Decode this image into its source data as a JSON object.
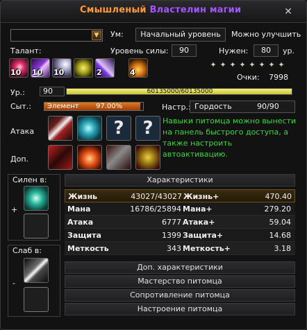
{
  "window": {
    "title_part1": "Смышленый",
    "title_part2": "Властелин магии"
  },
  "mind": {
    "label": "Ум:",
    "value": "Начальный уровень",
    "improve": "Можно улучшить"
  },
  "talent": {
    "label": "Талант:"
  },
  "talents": [
    {
      "level": "10",
      "icon": "pink-burst-icon"
    },
    {
      "level": "10",
      "icon": "purple-beam-icon"
    },
    {
      "level": "10",
      "icon": "white-rays-icon"
    },
    {
      "level": "",
      "icon": "yellow-orb-icon"
    },
    {
      "level": "2",
      "icon": "violet-slash-icon"
    },
    {
      "level": "4",
      "icon": "orange-spiral-icon"
    }
  ],
  "power": {
    "label": "Уровень силы:",
    "value": "90"
  },
  "needed": {
    "label": "Нужен:",
    "value": "80",
    "unit": "ур."
  },
  "points": {
    "label": "Очки:",
    "value": "7998",
    "stars_filled": 8,
    "stars_total": 8
  },
  "level": {
    "label": "Ур.:",
    "value": "90",
    "xp_text": "60135000/60135000",
    "xp_fraction": 1.0
  },
  "satiety": {
    "label": "Сыт.:",
    "element_label": "Элемент",
    "value_text": "97.00%",
    "fraction": 0.97
  },
  "mood": {
    "label": "Настр.:",
    "value": "Гордость",
    "count": "90/90"
  },
  "attack": {
    "label": "Атака"
  },
  "extra": {
    "label": "Доп."
  },
  "info_text": "Навыки питомца можно вынести на панель быстрого доступа, а также настроить автоактивацию.",
  "strong": {
    "label": "Силен в:",
    "sign": "+"
  },
  "weak": {
    "label": "Слаб в:",
    "sign": "-"
  },
  "characteristics": {
    "header": "Характеристики",
    "rows": [
      {
        "k1": "Жизнь",
        "v1": "43027/43027",
        "k2": "Жизнь+",
        "v2": "470.40"
      },
      {
        "k1": "Мана",
        "v1": "16786/25894",
        "k2": "Мана+",
        "v2": "279.20"
      },
      {
        "k1": "Атака",
        "v1": "6777",
        "k2": "Атака+",
        "v2": "59.04"
      },
      {
        "k1": "Защита",
        "v1": "1399",
        "k2": "Защита+",
        "v2": "14.68"
      },
      {
        "k1": "Меткость",
        "v1": "343",
        "k2": "Меткость+",
        "v2": "3.18"
      }
    ]
  },
  "sections": [
    "Доп. характеристики",
    "Мастерство питомца",
    "Сопротивление питомца",
    "Настроение питомца"
  ],
  "colors": {
    "title_orange": "#ff9a3a",
    "title_purple": "#a355ff",
    "info_green": "#39d939",
    "xp_yellow": "#e6e36a",
    "satiety_orange": "#d46a18"
  }
}
